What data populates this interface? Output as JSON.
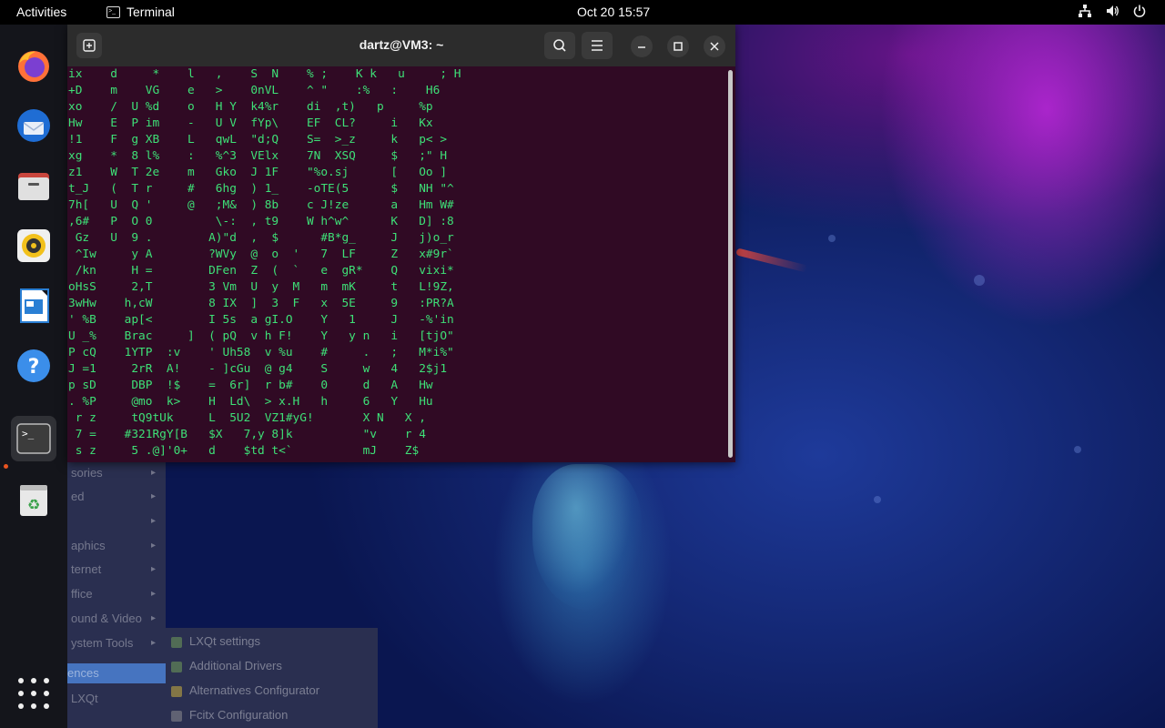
{
  "topbar": {
    "activities_label": "Activities",
    "app_name": "Terminal",
    "clock": "Oct 20  15:57"
  },
  "window": {
    "title": "dartz@VM3: ~",
    "lines": [
      "ix    d     *    l   ,    S  N    % ;    K k   u     ; H",
      "+D    m    VG    e   >    0nVL    ^ \"    :%   :    H6",
      "xo    /  U %d    o   H Y  k4%r    di  ,t)   p     %p",
      "Hw    E  P im    -   U V  fYp\\    EF  CL?     i   Kx",
      "!1    F  g XB    L   qwL  \"d;Q    S=  >_z     k   p< >",
      "xg    *  8 l%    :   %^3  VElx    7N  XSQ     $   ;\" H",
      "z1    W  T 2e    m   Gko  J 1F    \"%o.sj      [   Oo ]",
      "t_J   (  T r     #   6hg  ) 1_    -oTE(5      $   NH \"^",
      "7h[   U  Q '     @   ;M&  ) 8b    c J!ze      a   Hm W#",
      ",6#   P  O 0         \\-:  , t9    W h^w^      K   D] :8",
      " Gz   U  9 .        A)\"d  ,  $      #B*g_     J   j)o_r",
      " ^Iw     y A        ?WVy  @  o  '   7  LF     Z   x#9r`",
      " /kn     H =        DFen  Z  (  `   e  gR*    Q   vixi*",
      "oHsS     2,T        3 Vm  U  y  M   m  mK     t   L!9Z,",
      "3wHw    h,cW        8 IX  ]  3  F   x  5E     9   :PR?A",
      "' %B    ap[<        I 5s  a gI.O    Y   1     J   -%'in",
      "U _%    Brac     ]  ( pQ  v h F!    Y   y n   i   [tjO\"",
      "P cQ    1YTP  :v    ' Uh58  v %u    #     .   ;   M*i%\"",
      "J =1     2rR  A!    - ]cGu  @ g4    S     w   4   2$j1",
      "p sD     DBP  !$    =  6r]  r b#    0     d   A   Hw",
      ". %P     @mo  k>    H  Ld\\  > x.H   h     6   Y   Hu",
      " r z     tQ9tUk     L  5U2  VZ1#yG!       X N   X ,",
      " 7 =    #321RgY[B   $X   7,y 8]k          \"v    r 4",
      " s z     5 .@]'0+   d    $td t<`          mJ    Z$"
    ]
  },
  "dock": {
    "apps": [
      "firefox-icon",
      "thunderbird-icon",
      "files-icon",
      "rhythmbox-icon",
      "libreoffice-writer-icon",
      "help-icon",
      "terminal-icon",
      "trash-icon"
    ]
  },
  "background_menu": {
    "items": [
      {
        "label": "sories"
      },
      {
        "label": "ed"
      },
      {
        "label": ""
      },
      {
        "label": "aphics"
      },
      {
        "label": "ternet"
      },
      {
        "label": "ffice"
      },
      {
        "label": "ound & Video"
      },
      {
        "label": "ystem Tools"
      },
      {
        "label": "ences"
      },
      {
        "label": "LXQt"
      }
    ],
    "submenu": [
      {
        "label": "LXQt settings"
      },
      {
        "label": "Additional Drivers"
      },
      {
        "label": "Alternatives Configurator"
      },
      {
        "label": "Fcitx Configuration"
      }
    ]
  }
}
